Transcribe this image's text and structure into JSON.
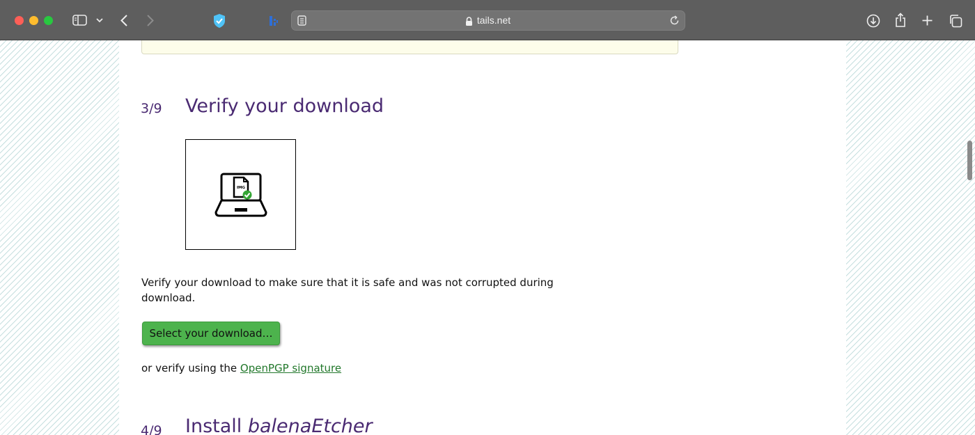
{
  "browser": {
    "address": "tails.net",
    "colors": {
      "toolbar": "#5e5e5e",
      "address_bar": "#737373"
    },
    "icons": [
      "sidebar-icon",
      "chevron-down-icon",
      "back-icon",
      "forward-icon",
      "shield-check-icon",
      "extension-icon",
      "reader-icon",
      "lock-icon",
      "reload-icon",
      "download-icon",
      "share-icon",
      "new-tab-icon",
      "tabs-overview-icon"
    ]
  },
  "page": {
    "step3": {
      "number": "3/9",
      "title": "Verify your download",
      "description": "Verify your download to make sure that it is safe and was not corrupted during download.",
      "button_label": "Select your download…",
      "alt_prefix": "or verify using the ",
      "alt_link": "OpenPGP signature",
      "illustration_label": "IMG"
    },
    "step4": {
      "number": "4/9",
      "title_prefix": "Install ",
      "title_emphasis": "balenaEtcher"
    },
    "colors": {
      "heading": "#4a2a72",
      "button": "#4db34d",
      "link": "#21772a"
    }
  }
}
